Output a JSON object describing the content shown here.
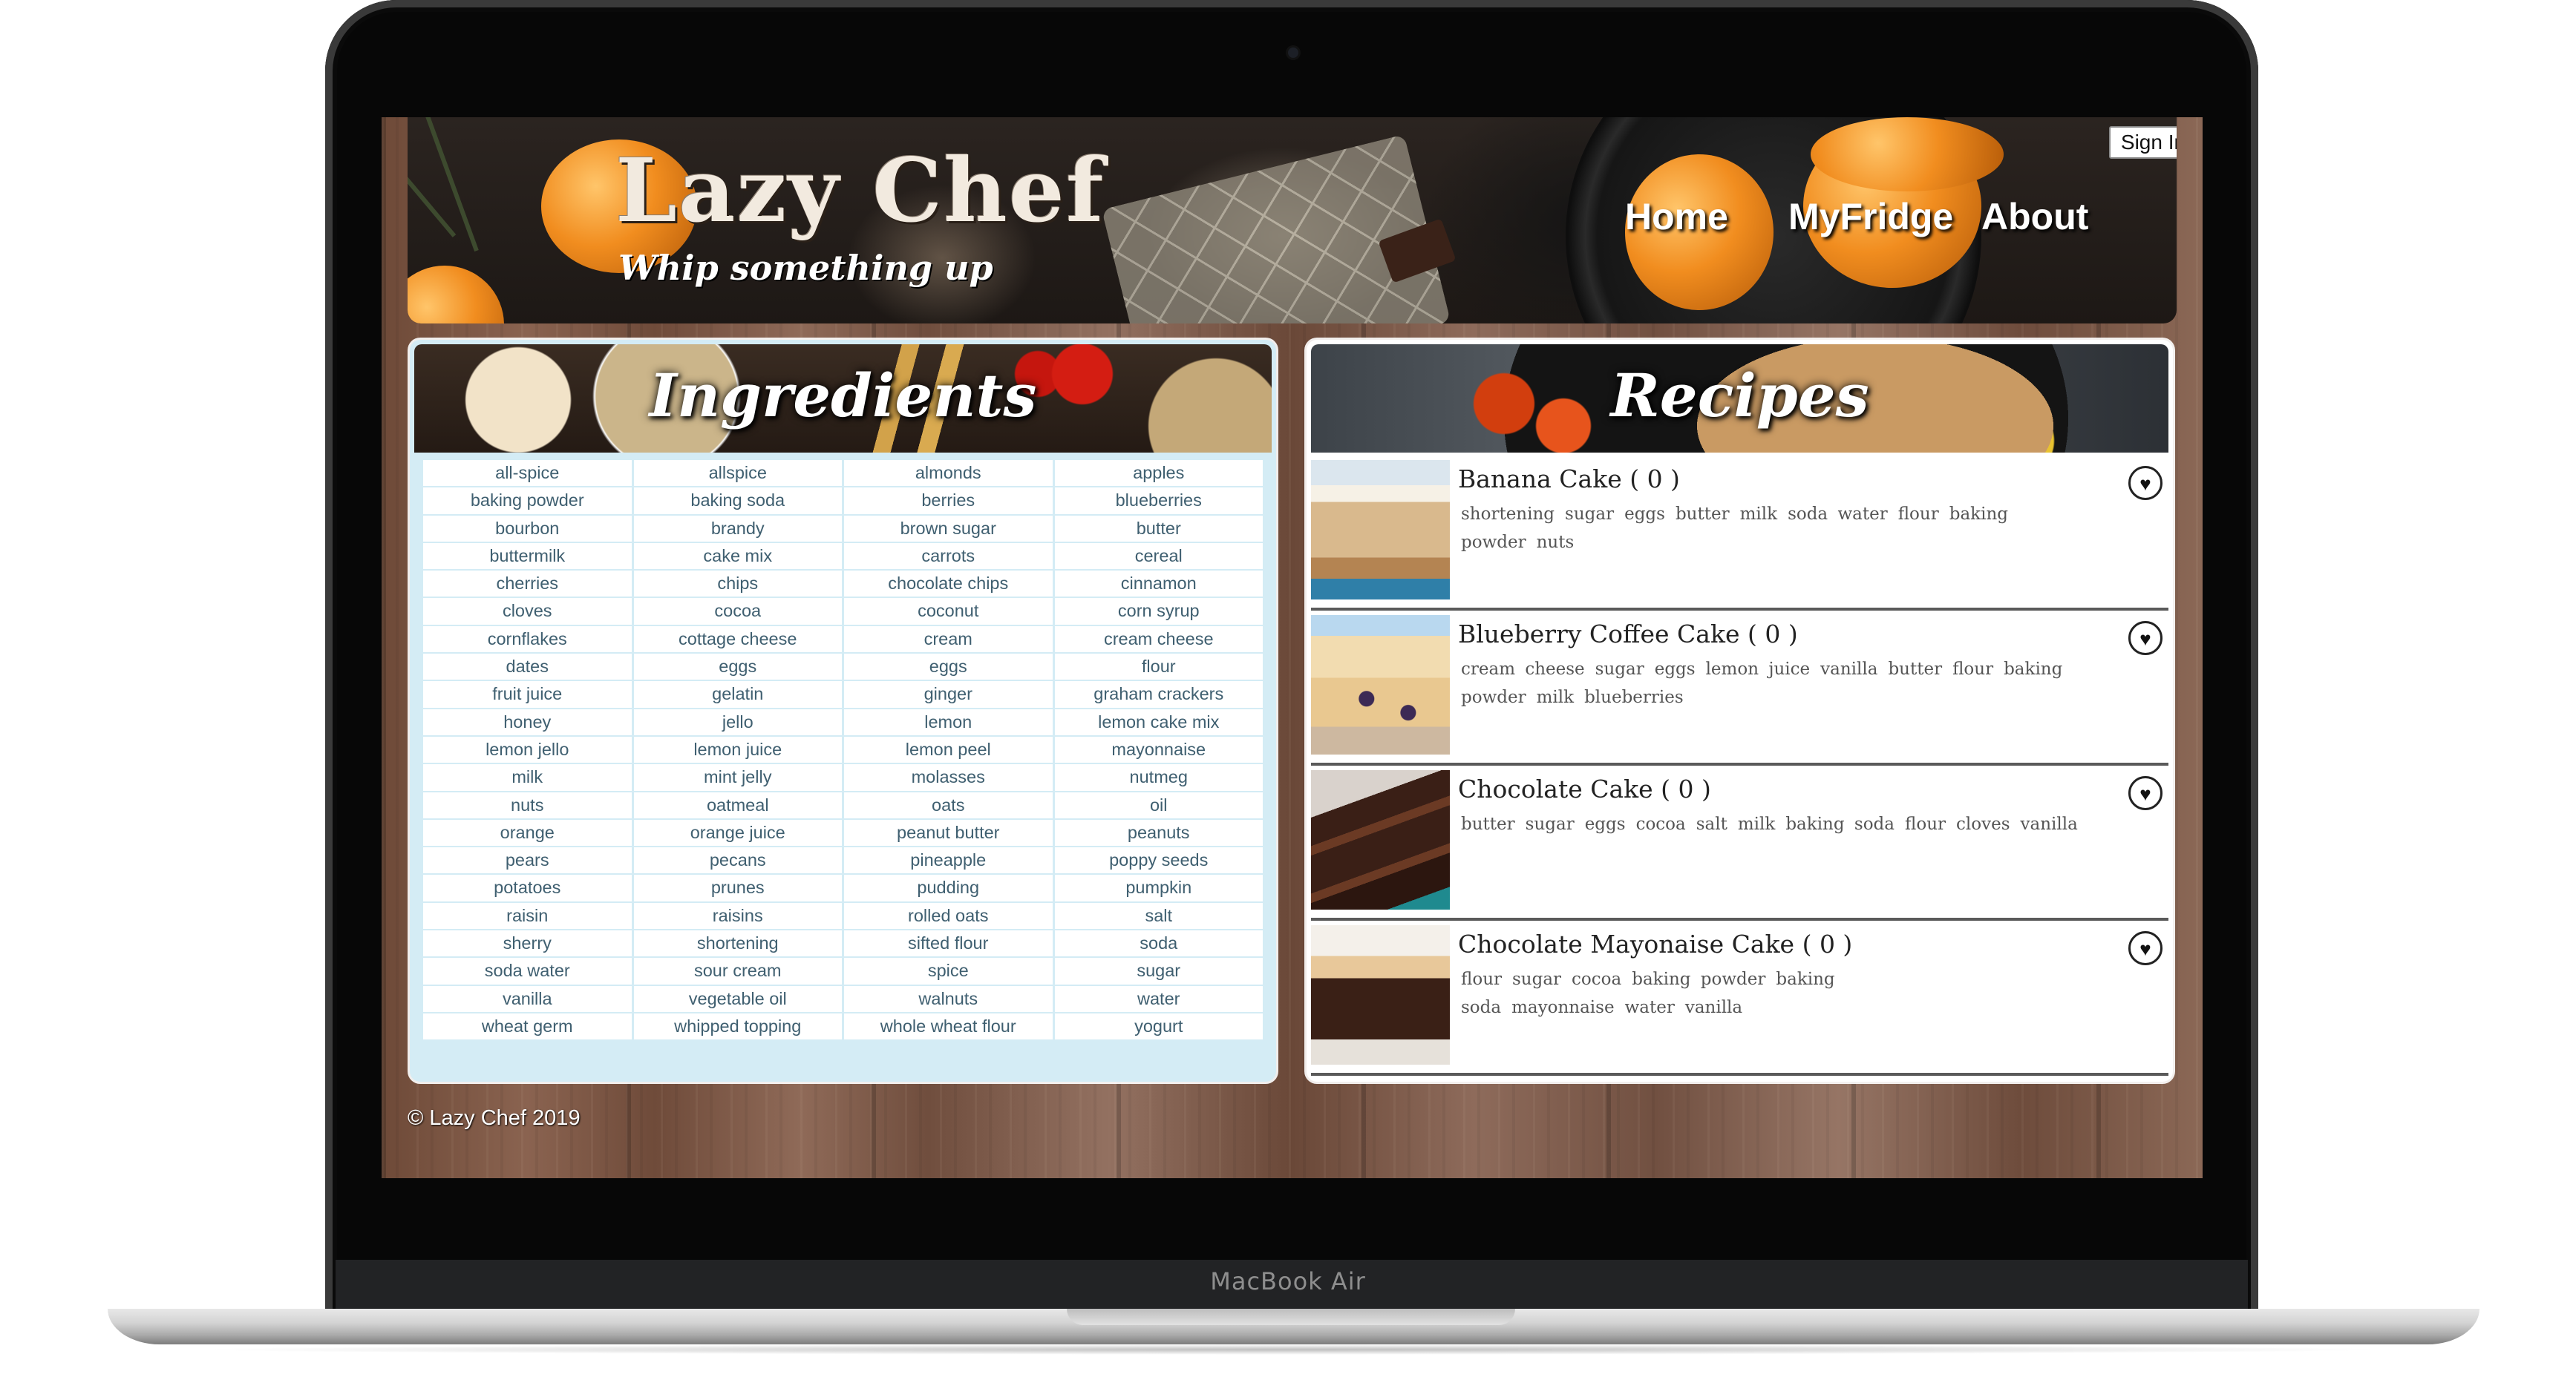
{
  "device": {
    "label": "MacBook Air"
  },
  "header": {
    "title": "Lazy Chef",
    "tagline": "Whip something up",
    "nav": [
      "Home",
      "MyFridge",
      "About"
    ],
    "sign_in": "Sign In"
  },
  "ingredients": {
    "title": "Ingredients",
    "items": [
      "all-spice",
      "allspice",
      "almonds",
      "apples",
      "baking powder",
      "baking soda",
      "berries",
      "blueberries",
      "bourbon",
      "brandy",
      "brown sugar",
      "butter",
      "buttermilk",
      "cake mix",
      "carrots",
      "cereal",
      "cherries",
      "chips",
      "chocolate chips",
      "cinnamon",
      "cloves",
      "cocoa",
      "coconut",
      "corn syrup",
      "cornflakes",
      "cottage cheese",
      "cream",
      "cream cheese",
      "dates",
      "eggs",
      "eggs",
      "flour",
      "fruit juice",
      "gelatin",
      "ginger",
      "graham crackers",
      "honey",
      "jello",
      "lemon",
      "lemon cake mix",
      "lemon jello",
      "lemon juice",
      "lemon peel",
      "mayonnaise",
      "milk",
      "mint jelly",
      "molasses",
      "nutmeg",
      "nuts",
      "oatmeal",
      "oats",
      "oil",
      "orange",
      "orange juice",
      "peanut butter",
      "peanuts",
      "pears",
      "pecans",
      "pineapple",
      "poppy seeds",
      "potatoes",
      "prunes",
      "pudding",
      "pumpkin",
      "raisin",
      "raisins",
      "rolled oats",
      "salt",
      "sherry",
      "shortening",
      "sifted flour",
      "soda",
      "soda water",
      "sour cream",
      "spice",
      "sugar",
      "vanilla",
      "vegetable oil",
      "walnuts",
      "water",
      "wheat germ",
      "whipped topping",
      "whole wheat flour",
      "yogurt"
    ]
  },
  "recipes": {
    "title": "Recipes",
    "items": [
      {
        "name": "Banana Cake ( 0 )",
        "ingredients": [
          "shortening",
          "sugar",
          "eggs",
          "butter",
          "milk",
          "soda water",
          "flour",
          "baking powder",
          "nuts"
        ]
      },
      {
        "name": "Blueberry Coffee Cake ( 0 )",
        "ingredients": [
          "cream cheese",
          "sugar",
          "eggs",
          "lemon juice",
          "vanilla",
          "butter",
          "flour",
          "baking powder",
          "milk",
          "blueberries"
        ]
      },
      {
        "name": "Chocolate Cake ( 0 )",
        "ingredients": [
          "butter",
          "sugar",
          "eggs",
          "cocoa",
          "salt",
          "milk",
          "baking soda",
          "flour",
          "cloves",
          "vanilla"
        ]
      },
      {
        "name": "Chocolate Mayonaise Cake ( 0 )",
        "ingredients": [
          "flour",
          "sugar",
          "cocoa",
          "baking powder",
          "baking soda",
          "mayonnaise",
          "water",
          "vanilla"
        ]
      }
    ],
    "favorite_icon": "heart-icon"
  },
  "footer": {
    "text": "© Lazy Chef 2019"
  }
}
